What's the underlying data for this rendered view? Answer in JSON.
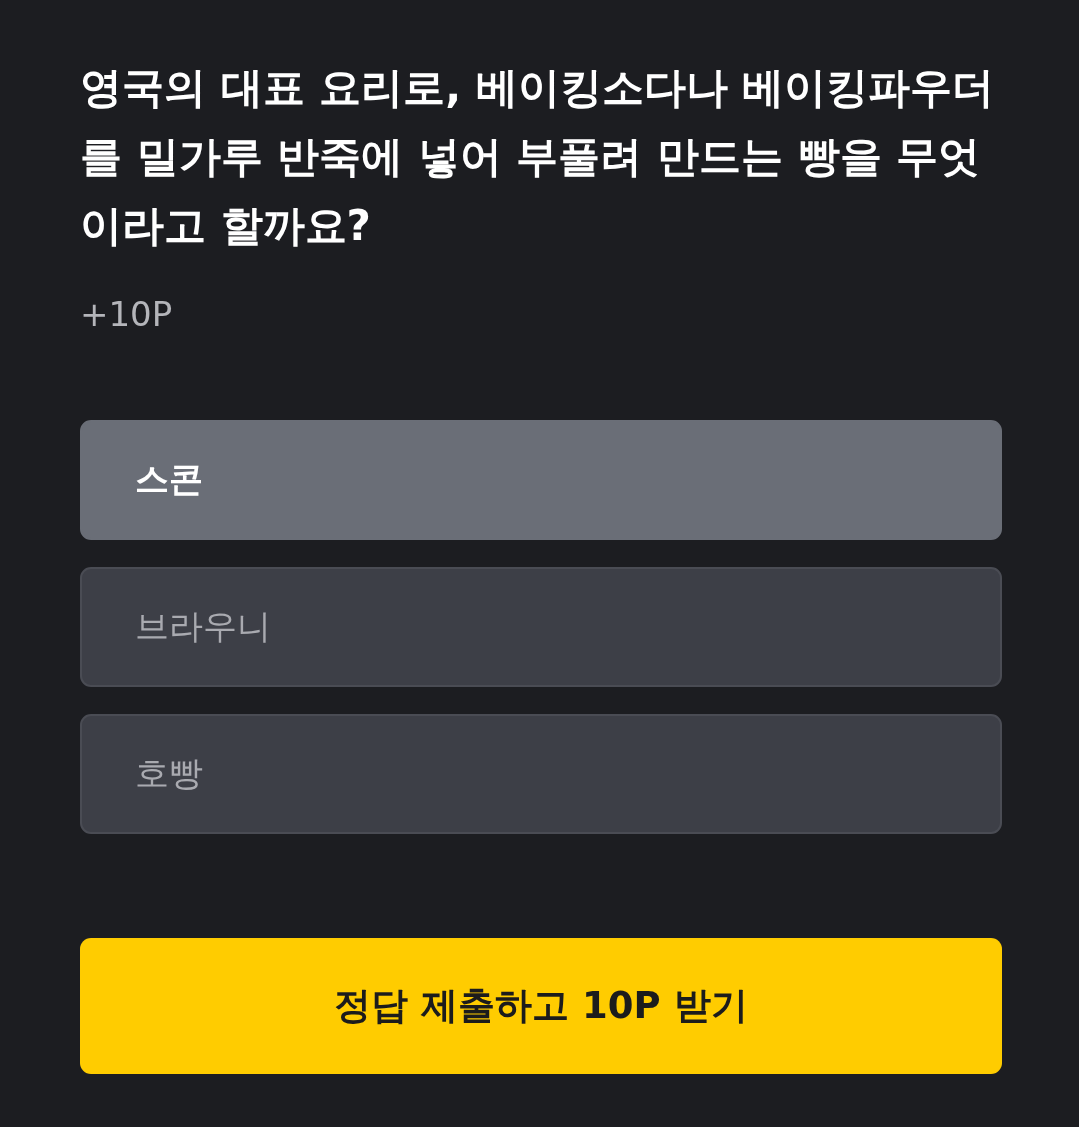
{
  "question": "영국의 대표 요리로, 베이킹소다나 베이킹파우더를 밀가루 반죽에 넣어 부풀려 만드는 빵을 무엇이라고 할까요?",
  "points": "+10P",
  "options": [
    {
      "label": "스콘",
      "selected": true
    },
    {
      "label": "브라우니",
      "selected": false
    },
    {
      "label": "호빵",
      "selected": false
    }
  ],
  "submit_button": "정답 제출하고 10P 받기"
}
